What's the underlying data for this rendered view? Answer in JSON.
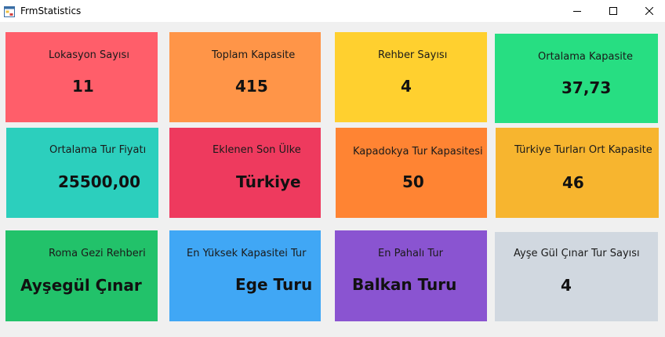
{
  "window": {
    "title": "FrmStatistics",
    "icon": "form-icon",
    "controls": [
      "minimize-icon",
      "maximize-icon",
      "close-icon"
    ]
  },
  "cards": [
    {
      "label": "Lokasyon Sayısı",
      "value": "11",
      "color": "#ff5e6a"
    },
    {
      "label": "Toplam Kapasite",
      "value": "415",
      "color": "#ff9548"
    },
    {
      "label": "Rehber Sayısı",
      "value": "4",
      "color": "#ffd02f"
    },
    {
      "label": "Ortalama Kapasite",
      "value": "37,73",
      "color": "#27de82"
    },
    {
      "label": "Ortalama Tur Fiyatı",
      "value": "25500,00",
      "color": "#2ccfbd"
    },
    {
      "label": "Eklenen Son Ülke",
      "value": "Türkiye",
      "color": "#ee3a5e"
    },
    {
      "label": "Kapadokya Tur Kapasitesi",
      "value": "50",
      "color": "#ff8433"
    },
    {
      "label": "Türkiye Turları Ort Kapasite",
      "value": "46",
      "color": "#f7b52f"
    },
    {
      "label": "Roma Gezi Rehberi",
      "value": "Ayşegül  Çınar",
      "color": "#22c26a"
    },
    {
      "label": "En Yüksek Kapasitei Tur",
      "value": "Ege Turu",
      "color": "#40a7f5"
    },
    {
      "label": "En Pahalı Tur",
      "value": "Balkan Turu",
      "color": "#8a54d1"
    },
    {
      "label": "Ayşe Gül Çınar Tur Sayısı",
      "value": "4",
      "color": "#d1d8e0"
    }
  ]
}
